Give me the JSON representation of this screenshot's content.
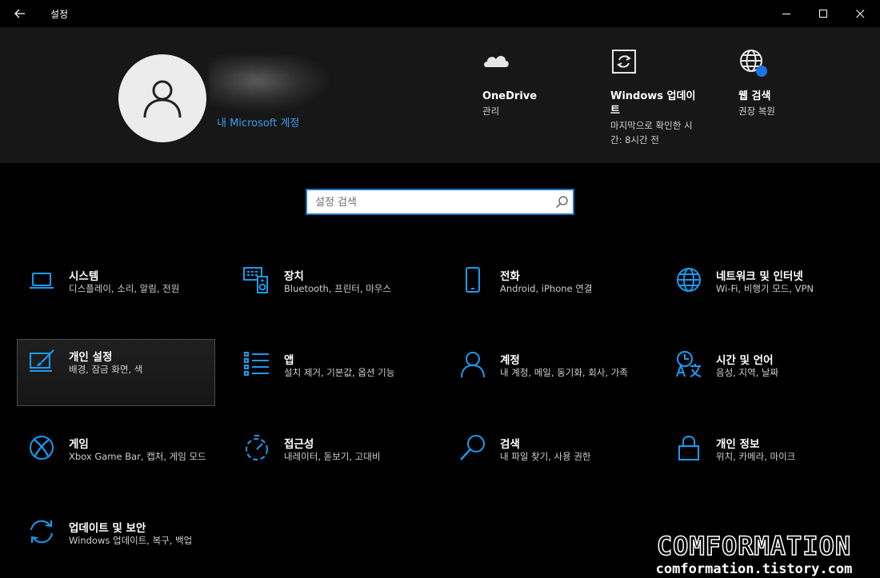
{
  "window": {
    "title": "설정",
    "back_glyph": "←"
  },
  "header": {
    "account_link": "내 Microsoft 계정",
    "items": [
      {
        "icon": "onedrive-icon",
        "title": "OneDrive",
        "sub": "관리"
      },
      {
        "icon": "windows-update-icon",
        "title": "Windows 업데이트",
        "sub": "마지막으로 확인한 시간: 8시간 전"
      },
      {
        "icon": "web-search-icon",
        "title": "웹 검색",
        "sub": "권장 복원"
      }
    ]
  },
  "search": {
    "placeholder": "설정 검색",
    "value": ""
  },
  "tiles": [
    {
      "icon": "laptop-icon",
      "title": "시스템",
      "sub": "디스플레이, 소리, 알림, 전원"
    },
    {
      "icon": "devices-icon",
      "title": "장치",
      "sub": "Bluetooth, 프린터, 마우스"
    },
    {
      "icon": "phone-icon",
      "title": "전화",
      "sub": "Android, iPhone 연결"
    },
    {
      "icon": "globe-icon",
      "title": "네트워크 및 인터넷",
      "sub": "Wi-Fi, 비행기 모드, VPN"
    },
    {
      "icon": "personalization-icon",
      "title": "개인 설정",
      "sub": "배경, 잠금 화면, 색",
      "selected": true
    },
    {
      "icon": "apps-icon",
      "title": "앱",
      "sub": "설치 제거, 기본값, 옵션 기능"
    },
    {
      "icon": "person-icon",
      "title": "계정",
      "sub": "내 계정, 메일, 동기화, 회사, 가족"
    },
    {
      "icon": "time-language-icon",
      "title": "시간 및 언어",
      "sub": "음성, 지역, 날짜"
    },
    {
      "icon": "xbox-icon",
      "title": "게임",
      "sub": "Xbox Game Bar, 캡처, 게임 모드"
    },
    {
      "icon": "ease-of-access-icon",
      "title": "접근성",
      "sub": "내레이터, 돋보기, 고대비"
    },
    {
      "icon": "search-icon",
      "title": "검색",
      "sub": "내 파일 찾기, 사용 권한"
    },
    {
      "icon": "lock-icon",
      "title": "개인 정보",
      "sub": "위치, 카메라, 마이크"
    },
    {
      "icon": "update-security-icon",
      "title": "업데이트 및 보안",
      "sub": "Windows 업데이트, 복구, 백업"
    }
  ],
  "watermark": {
    "brand": "COMFORMATION",
    "url": "comformation.tistory.com"
  },
  "colors": {
    "accent": "#1a9bf0",
    "link": "#3a9cf0",
    "background": "#000000",
    "header_bg": "#171717"
  }
}
